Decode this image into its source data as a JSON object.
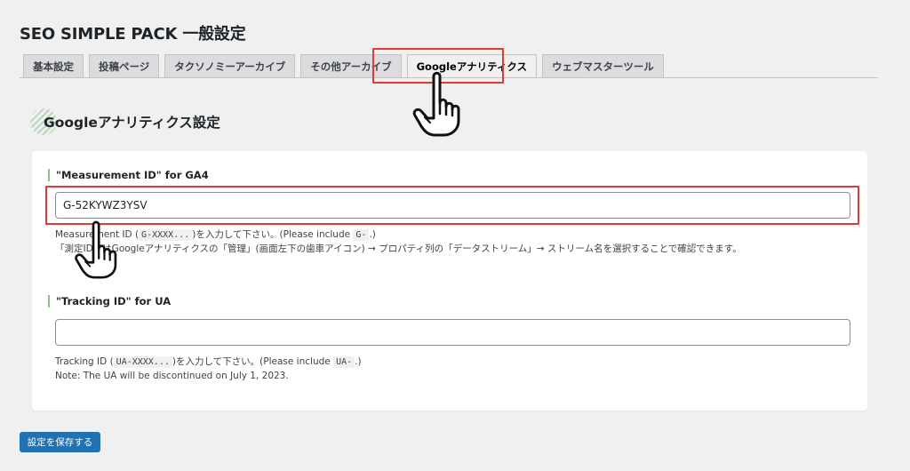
{
  "page": {
    "title": "SEO SIMPLE PACK 一般設定"
  },
  "tabs": [
    {
      "label": "基本設定",
      "active": false
    },
    {
      "label": "投稿ページ",
      "active": false
    },
    {
      "label": "タクソノミーアーカイブ",
      "active": false
    },
    {
      "label": "その他アーカイブ",
      "active": false
    },
    {
      "label": "Googleアナリティクス",
      "active": true
    },
    {
      "label": "ウェブマスターツール",
      "active": false
    }
  ],
  "section": {
    "heading": "Googleアナリティクス設定"
  },
  "ga4": {
    "label": "\"Measurement ID\" for GA4",
    "value": "G-52KYWZ3YSV",
    "desc1_pre": "Measurement ID (",
    "desc1_code1": "G-XXXX...",
    "desc1_mid": ")を入力して下さい。(Please include ",
    "desc1_code2": "G-",
    "desc1_post": ".)",
    "desc2": "「測定ID」はGoogleアナリティクスの「管理」(画面左下の歯車アイコン) → プロパティ列の「データストリーム」→ ストリーム名を選択することで確認できます。"
  },
  "ua": {
    "label": "\"Tracking ID\" for UA",
    "value": "",
    "desc1_pre": "Tracking ID (",
    "desc1_code1": "UA-XXXX...",
    "desc1_mid": ")を入力して下さい。(Please include ",
    "desc1_code2": "UA-",
    "desc1_post": ".)",
    "desc2": "Note: The UA will be discontinued on July 1, 2023."
  },
  "actions": {
    "save_label": "設定を保存する"
  },
  "colors": {
    "accent": "#2271b1",
    "highlight": "#e53935",
    "heading_deco": "#8ac28a"
  },
  "icons": [
    "pointing-hand-icon"
  ]
}
